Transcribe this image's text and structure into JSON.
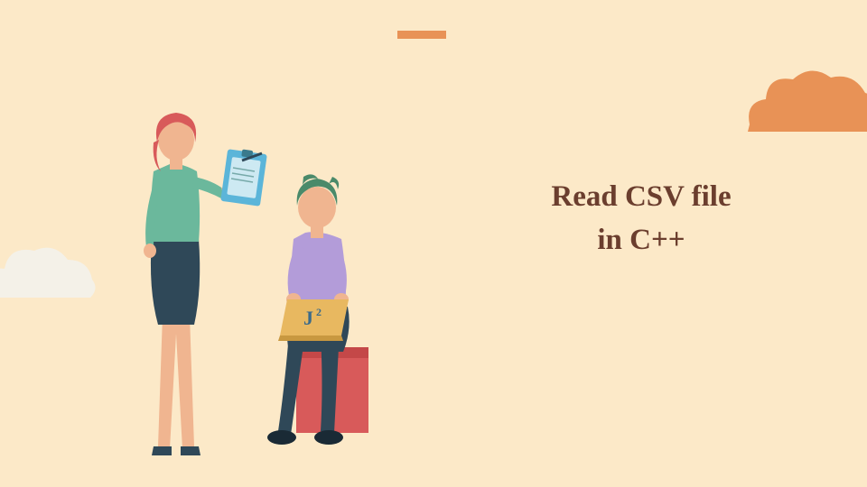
{
  "title": {
    "line1": "Read CSV file",
    "line2": "in C++"
  },
  "laptop_logo": {
    "text": "J",
    "superscript": "2"
  },
  "colors": {
    "background": "#fce9c8",
    "accent": "#e89256",
    "title_text": "#6b3e2e",
    "cloud_left": "#f4f1e8",
    "cloud_right": "#e89256"
  }
}
